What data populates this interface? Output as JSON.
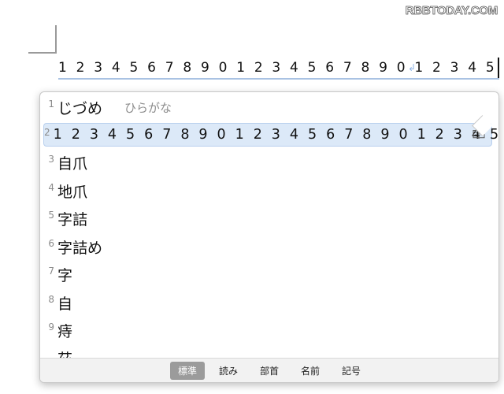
{
  "watermark": "RBBTODAY.COM",
  "document": {
    "input_text": "1 2 3 4 5 6 7 8 9 0 1 2 3 4 5 6 7 8 9 0 1 2 3 4 5",
    "return_mark": "↲"
  },
  "candidates": [
    {
      "num": "1",
      "text": "じづめ",
      "sub": "ひらがな"
    },
    {
      "num": "2",
      "text": "1 2 3 4 5 6 7 8 9 0 1 2 3 4 5 6 7 8 9 0 1 2 3 4 5",
      "selected": true,
      "icon": "dictionary-icon"
    },
    {
      "num": "3",
      "text": "自爪"
    },
    {
      "num": "4",
      "text": "地爪"
    },
    {
      "num": "5",
      "text": "字詰"
    },
    {
      "num": "6",
      "text": "字詰め"
    },
    {
      "num": "7",
      "text": "字"
    },
    {
      "num": "8",
      "text": "自"
    },
    {
      "num": "9",
      "text": "痔"
    },
    {
      "num": "",
      "text": "茲"
    }
  ],
  "tabs": [
    {
      "label": "標準",
      "active": true
    },
    {
      "label": "読み"
    },
    {
      "label": "部首"
    },
    {
      "label": "名前"
    },
    {
      "label": "記号"
    }
  ]
}
